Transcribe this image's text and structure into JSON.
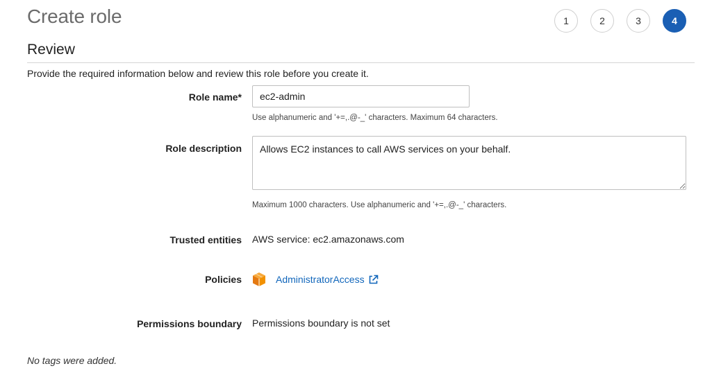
{
  "page": {
    "title": "Create role"
  },
  "steps": [
    {
      "label": "1",
      "active": false
    },
    {
      "label": "2",
      "active": false
    },
    {
      "label": "3",
      "active": false
    },
    {
      "label": "4",
      "active": true
    }
  ],
  "review": {
    "heading": "Review",
    "intro": "Provide the required information below and review this role before you create it."
  },
  "form": {
    "role_name": {
      "label": "Role name*",
      "value": "ec2-admin",
      "hint": "Use alphanumeric and '+=,.@-_' characters. Maximum 64 characters."
    },
    "role_description": {
      "label": "Role description",
      "value": "Allows EC2 instances to call AWS services on your behalf.",
      "hint": "Maximum 1000 characters. Use alphanumeric and '+=,.@-_' characters."
    },
    "trusted_entities": {
      "label": "Trusted entities",
      "value": "AWS service: ec2.amazonaws.com"
    },
    "policies": {
      "label": "Policies",
      "items": [
        {
          "name": "AdministratorAccess",
          "icon": "aws-policy-cube-icon"
        }
      ]
    },
    "permissions_boundary": {
      "label": "Permissions boundary",
      "value": "Permissions boundary is not set"
    }
  },
  "tags": {
    "message": "No tags were added."
  },
  "colors": {
    "accent": "#1a5fb4",
    "link": "#1166bb",
    "policy_icon": "#f29100"
  }
}
